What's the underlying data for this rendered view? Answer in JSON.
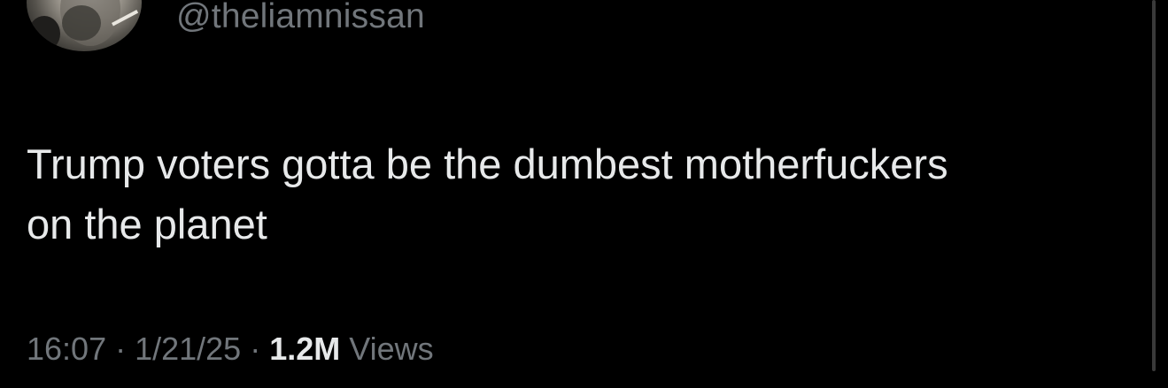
{
  "author": {
    "handle": "@theliamnissan",
    "avatar_icon": "profile-photo"
  },
  "tweet": {
    "text": "Trump voters gotta be the dumbest motherfuckers\non the planet",
    "time": "16:07",
    "separator": " · ",
    "date": "1/21/25",
    "views_count": "1.2M",
    "views_label": "Views"
  },
  "colors": {
    "background": "#000000",
    "primary_text": "#e7e9ea",
    "secondary_text": "#71767b"
  }
}
